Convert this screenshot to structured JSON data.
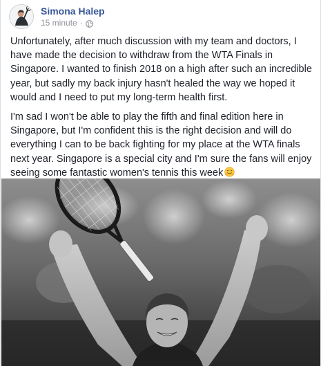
{
  "post": {
    "author": "Simona Halep",
    "time": "15 minute",
    "dot": "·",
    "paragraphs": [
      "Unfortunately, after much discussion with my team and doctors, I have made the decision to withdraw from the WTA Finals in Singapore. I wanted to finish 2018 on a high after such an incredible year, but sadly my back injury hasn't healed the way we hoped it would and I need to put my long-term health first.",
      "I'm sad I won't be able to play the fifth and final edition here in Singapore, but I'm confident this is the right decision and will do everything I can to be back fighting for my place at the WTA finals next year. Singapore is a special city and I'm sure the fans will enjoy seeing some fantastic women's tennis this week"
    ],
    "emoji": "hugging-face-emoji",
    "privacy_icon": "globe-icon",
    "avatar_icon": "avatar",
    "photo": "celebration-photo"
  },
  "colors": {
    "author": "#385898",
    "meta": "#90949c",
    "text": "#1d2129",
    "border": "#dddfe2"
  }
}
